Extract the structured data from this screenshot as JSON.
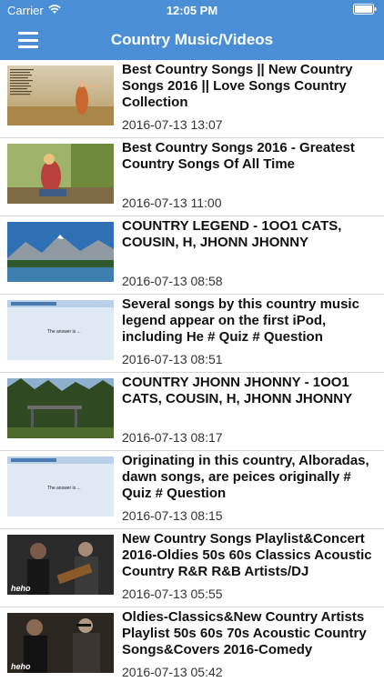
{
  "status": {
    "carrier": "Carrier",
    "time": "12:05 PM"
  },
  "nav": {
    "title": "Country Music/Videos",
    "menu_icon": "hamburger-menu-icon"
  },
  "colors": {
    "nav_bg": "#4a8fd6",
    "divider": "#d6d6d6"
  },
  "videos": [
    {
      "title": "Best Country Songs || New Country Songs 2016 || Love Songs Country Collection",
      "date": "2016-07-13 13:07"
    },
    {
      "title": "Best Country Songs 2016 - Greatest Country Songs Of All Time",
      "date": "2016-07-13 11:00"
    },
    {
      "title": "COUNTRY LEGEND - 1OO1 CATS, COUSIN, H, JHONN JHONNY",
      "date": "2016-07-13 08:58"
    },
    {
      "title": "Several songs by this country music legend appear on the first iPod, including He # Quiz # Question",
      "date": "2016-07-13 08:51",
      "thumb_text": "The answer is ..."
    },
    {
      "title": "COUNTRY JHONN JHONNY - 1OO1 CATS, COUSIN, H, JHONN JHONNY",
      "date": "2016-07-13 08:17"
    },
    {
      "title": "Originating in this country, Alboradas, dawn songs, are peices originally # Quiz # Question",
      "date": "2016-07-13 08:15",
      "thumb_text": "The answer is ..."
    },
    {
      "title": "New Country Songs Playlist&Concert 2016-Oldies 50s 60s Classics Acoustic Country R&R R&B Artists/DJ",
      "date": "2016-07-13 05:55",
      "thumb_text": "heho"
    },
    {
      "title": "Oldies-Classics&New Country Artists Playlist 50s 60s 70s Acoustic Country Songs&Covers 2016-Comedy",
      "date": "2016-07-13 05:42",
      "thumb_text": "heho"
    }
  ]
}
